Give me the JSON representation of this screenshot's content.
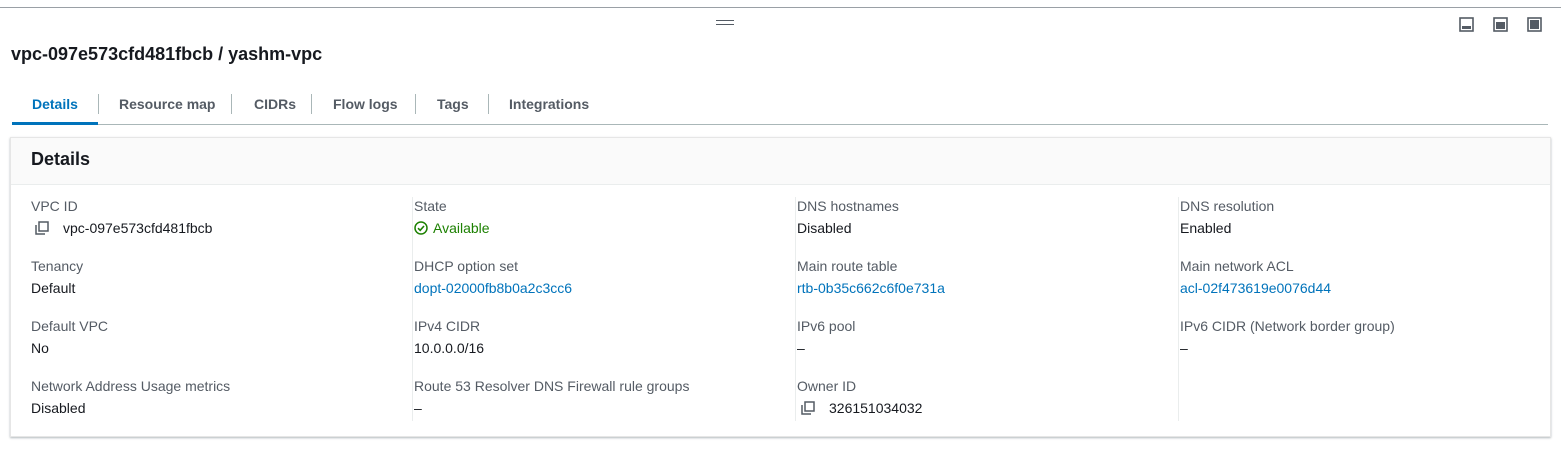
{
  "header": {
    "title": "vpc-097e573cfd481fbcb / yashm-vpc"
  },
  "window_controls": [
    {
      "icon": "panel-bottom-icon"
    },
    {
      "icon": "panel-side-icon"
    },
    {
      "icon": "panel-maximize-icon"
    }
  ],
  "tabs": [
    {
      "label": "Details",
      "active": true
    },
    {
      "label": "Resource map"
    },
    {
      "label": "CIDRs"
    },
    {
      "label": "Flow logs"
    },
    {
      "label": "Tags"
    },
    {
      "label": "Integrations"
    }
  ],
  "details": {
    "heading": "Details",
    "columns": [
      [
        {
          "label": "VPC ID",
          "value": "vpc-097e573cfd481fbcb",
          "copy": true
        },
        {
          "label": "Tenancy",
          "value": "Default"
        },
        {
          "label": "Default VPC",
          "value": "No"
        },
        {
          "label": "Network Address Usage metrics",
          "value": "Disabled"
        }
      ],
      [
        {
          "label": "State",
          "value": "Available",
          "status": "success"
        },
        {
          "label": "DHCP option set",
          "value": "dopt-02000fb8b0a2c3cc6",
          "link": true
        },
        {
          "label": "IPv4 CIDR",
          "value": "10.0.0.0/16"
        },
        {
          "label": "Route 53 Resolver DNS Firewall rule groups",
          "value": "–"
        }
      ],
      [
        {
          "label": "DNS hostnames",
          "value": "Disabled"
        },
        {
          "label": "Main route table",
          "value": "rtb-0b35c662c6f0e731a",
          "link": true
        },
        {
          "label": "IPv6 pool",
          "value": "–"
        },
        {
          "label": "Owner ID",
          "value": "326151034032",
          "copy": true
        }
      ],
      [
        {
          "label": "DNS resolution",
          "value": "Enabled"
        },
        {
          "label": "Main network ACL",
          "value": "acl-02f473619e0076d44",
          "link": true
        },
        {
          "label": "IPv6 CIDR (Network border group)",
          "value": "–"
        }
      ]
    ]
  },
  "colors": {
    "link": "#0073bb",
    "success": "#1d8102",
    "label": "#545b64"
  }
}
